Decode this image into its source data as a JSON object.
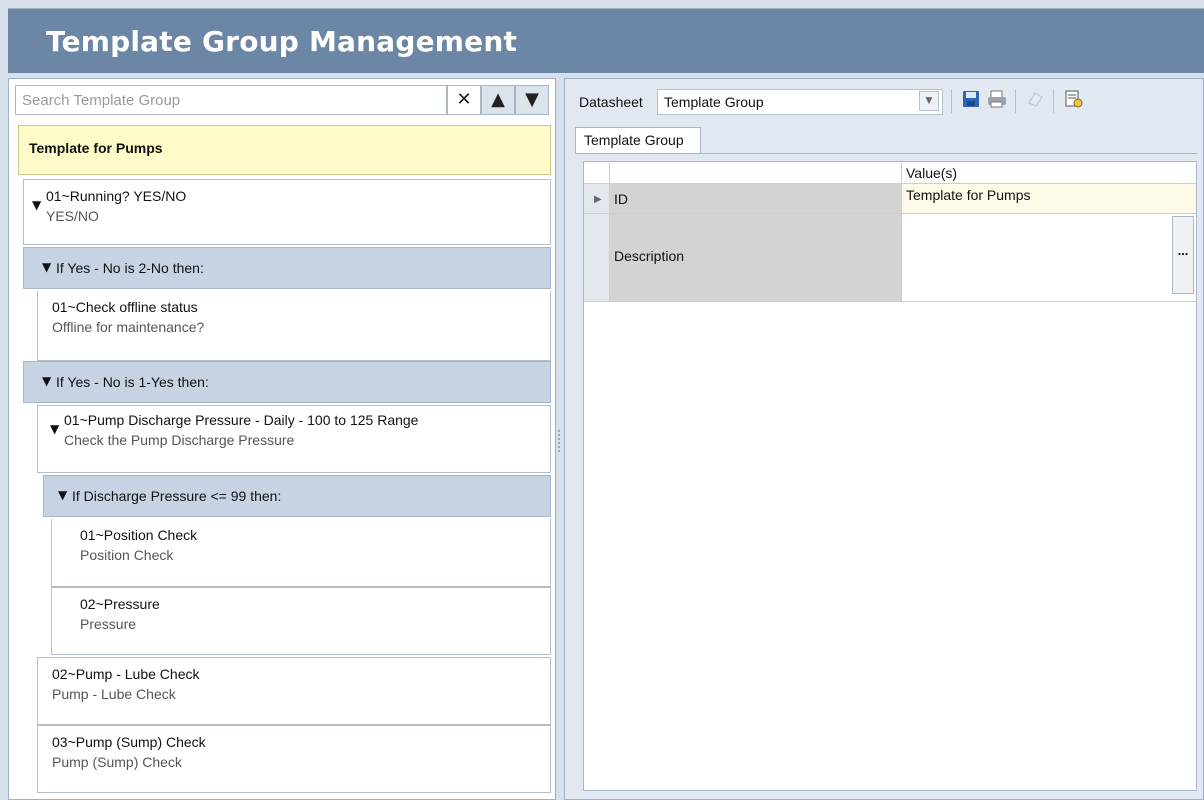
{
  "title": "Template Group Management",
  "search": {
    "placeholder": "Search Template Group",
    "clear": "✕",
    "up": "▲",
    "down": "▼"
  },
  "tree": {
    "group": "Template for Pumps",
    "nodes": [
      {
        "title": "01~Running? YES/NO",
        "sub": "YES/NO"
      },
      {
        "cond": "If Yes - No is 2-No then:"
      },
      {
        "title": "01~Check offline status",
        "sub": "Offline for maintenance?"
      },
      {
        "cond": "If Yes - No is 1-Yes then:"
      },
      {
        "title": "01~Pump Discharge Pressure - Daily - 100 to 125 Range",
        "sub": "Check the Pump Discharge Pressure"
      },
      {
        "cond": "If Discharge Pressure <= 99 then:"
      },
      {
        "title": "01~Position Check",
        "sub": "Position Check"
      },
      {
        "title": "02~Pressure",
        "sub": "Pressure"
      },
      {
        "title": "02~Pump - Lube Check",
        "sub": "Pump - Lube Check"
      },
      {
        "title": "03~Pump (Sump) Check",
        "sub": "Pump (Sump) Check"
      }
    ]
  },
  "datasheet": {
    "label": "Datasheet",
    "value": "Template Group"
  },
  "tab": "Template Group",
  "grid": {
    "header": "Value(s)",
    "rows": [
      {
        "name": "ID",
        "value": "Template for Pumps"
      },
      {
        "name": "Description",
        "value": ""
      }
    ],
    "ellipsis": "..."
  },
  "icons": [
    "save-icon",
    "print-icon",
    "clear-icon",
    "report-icon"
  ]
}
